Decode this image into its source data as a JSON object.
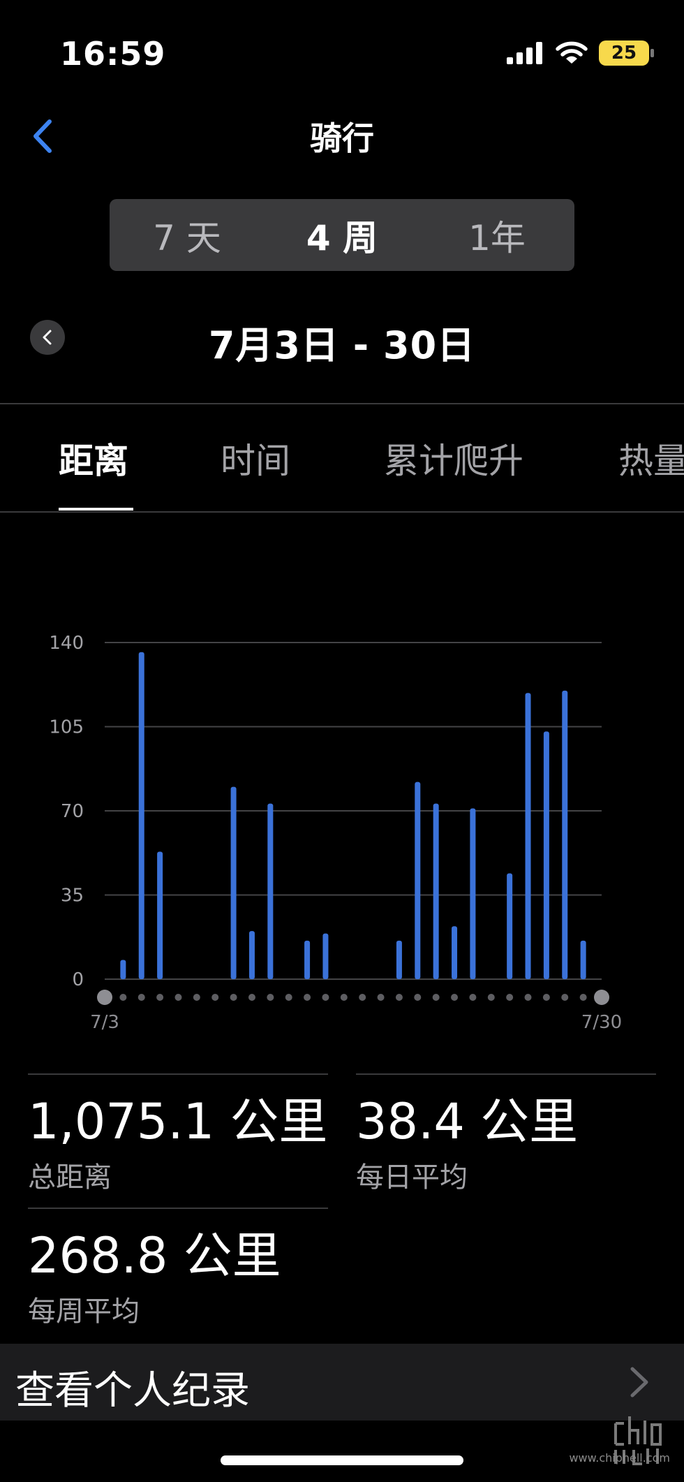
{
  "status_bar": {
    "time": "16:59",
    "battery": "25"
  },
  "nav": {
    "title": "骑行"
  },
  "range_selector": {
    "options": [
      {
        "label": "7 天",
        "active": false
      },
      {
        "label": "4 周",
        "active": true
      },
      {
        "label": "1年",
        "active": false
      }
    ]
  },
  "date_range": "7月3日 - 30日",
  "metric_tabs": [
    {
      "label": "距离",
      "active": true
    },
    {
      "label": "时间",
      "active": false
    },
    {
      "label": "累计爬升",
      "active": false
    },
    {
      "label": "热量",
      "active": false
    }
  ],
  "chart_data": {
    "type": "bar",
    "y_ticks": [
      "140",
      "105",
      "70",
      "35",
      "0"
    ],
    "ylim": [
      0,
      140
    ],
    "x_start_label": "7/3",
    "x_end_label": "7/30",
    "grid": true,
    "bar_color": "#3b72d9",
    "categories": [
      "7/3",
      "7/4",
      "7/5",
      "7/6",
      "7/7",
      "7/8",
      "7/9",
      "7/10",
      "7/11",
      "7/12",
      "7/13",
      "7/14",
      "7/15",
      "7/16",
      "7/17",
      "7/18",
      "7/19",
      "7/20",
      "7/21",
      "7/22",
      "7/23",
      "7/24",
      "7/25",
      "7/26",
      "7/27",
      "7/28",
      "7/29",
      "7/30"
    ],
    "values": [
      0,
      8,
      136,
      53,
      0,
      0,
      0,
      80,
      20,
      73,
      0,
      16,
      19,
      0,
      0,
      0,
      16,
      82,
      73,
      22,
      71,
      0,
      44,
      119,
      103,
      120,
      16,
      0
    ]
  },
  "stats": {
    "total_distance": {
      "value": "1,075.1 公里",
      "label": "总距离"
    },
    "daily_average": {
      "value": "38.4 公里",
      "label": "每日平均"
    },
    "weekly_average": {
      "value": "268.8 公里",
      "label": "每周平均"
    }
  },
  "records": {
    "label": "查看个人纪录"
  },
  "watermark": {
    "site": "www.chiphell.com"
  }
}
